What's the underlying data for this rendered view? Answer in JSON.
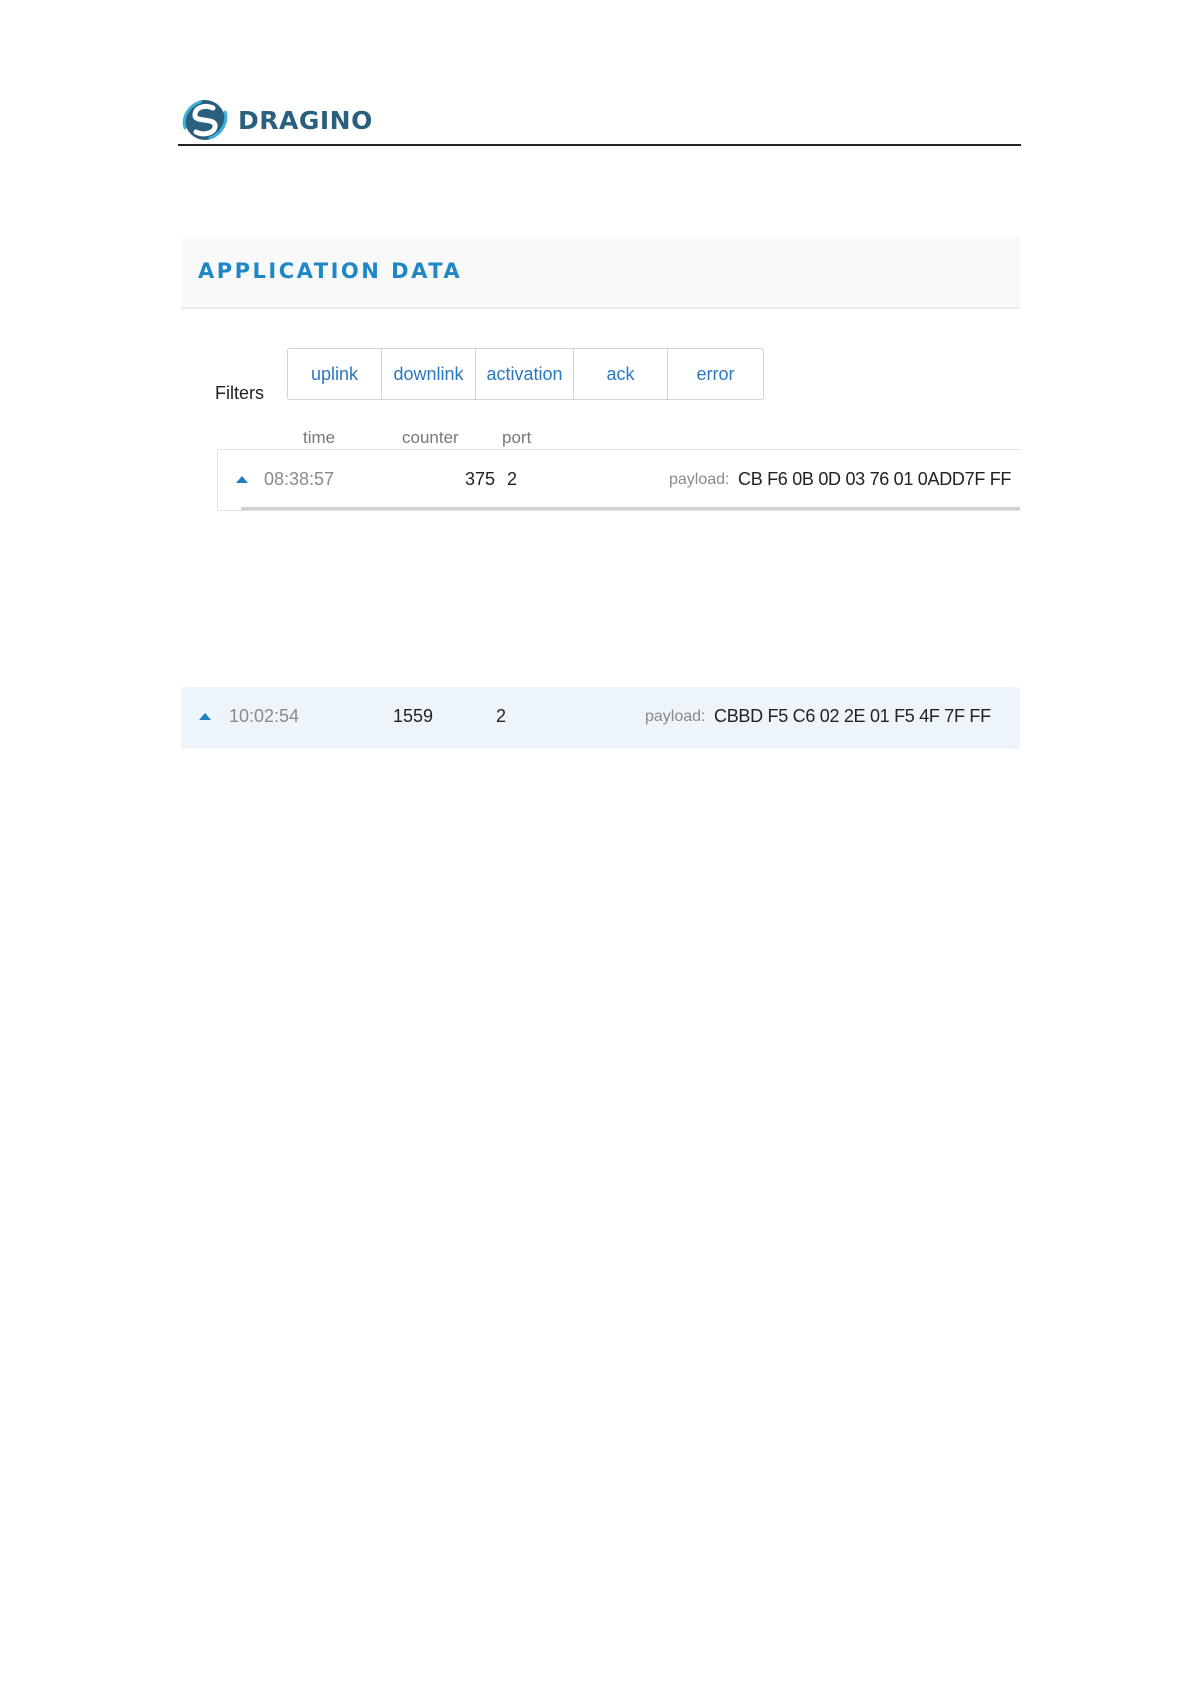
{
  "header": {
    "logo_text": "DRAGINO",
    "brand_color": "#2a5f7d"
  },
  "panel1": {
    "title": "APPLICATION DATA",
    "filters_label": "Filters",
    "filters": [
      "uplink",
      "downlink",
      "activation",
      "ack",
      "error"
    ],
    "columns": {
      "time": "time",
      "counter": "counter",
      "port": "port"
    },
    "row": {
      "time": "08:38:57",
      "counter": "375",
      "port": "2",
      "payload_label": "payload:",
      "payload": "CB F6 0B 0D 03 76 01 0ADD7F FF"
    },
    "accent_color": "#1e88c7"
  },
  "panel2": {
    "row": {
      "time": "10:02:54",
      "counter": "1559",
      "port": "2",
      "payload_label": "payload:",
      "payload": "CBBD F5 C6 02 2E 01 F5 4F 7F FF"
    }
  }
}
